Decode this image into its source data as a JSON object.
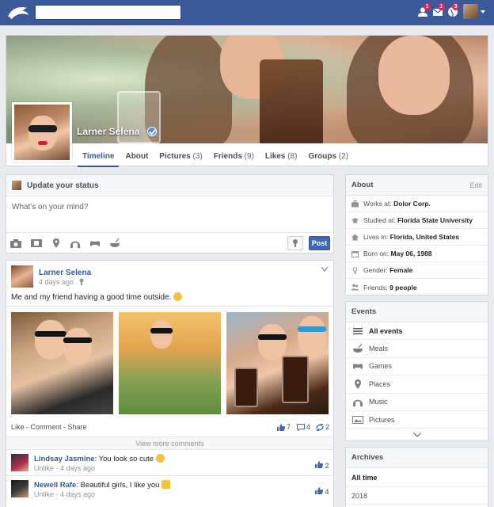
{
  "topbar": {
    "search_value": "",
    "notifications": [
      {
        "icon": "friend-requests-icon",
        "count": "1"
      },
      {
        "icon": "messages-icon",
        "count": "1"
      },
      {
        "icon": "globe-notifications-icon",
        "count": "3"
      }
    ],
    "brand_color": "#3b5998"
  },
  "profile": {
    "name": "Larner Selena",
    "tabs": [
      {
        "label": "Timeline",
        "count": ""
      },
      {
        "label": "About",
        "count": ""
      },
      {
        "label": "Pictures",
        "count": "(3)"
      },
      {
        "label": "Friends",
        "count": "(9)"
      },
      {
        "label": "Likes",
        "count": "(8)"
      },
      {
        "label": "Groups",
        "count": "(2)"
      }
    ]
  },
  "status": {
    "title": "Update your status",
    "placeholder": "What's on your mind?",
    "tools": [
      "camera-icon",
      "film-icon",
      "location-pin-icon",
      "headphones-icon",
      "gamepad-icon",
      "food-bowl-icon"
    ],
    "post_label": "Post"
  },
  "post": {
    "author": "Larner Selena",
    "time": "4 days ago",
    "text": "Me and my friend having a good time outside.",
    "actions": "Like - Comment - Share",
    "likes": "7",
    "comments": "4",
    "shares": "2",
    "more_comments": "View more comments",
    "comments_list": [
      {
        "author": "Lindsay Jasmine",
        "text": ": You look so cute",
        "meta": "Unlike - 4 days ago",
        "likes": "2"
      },
      {
        "author": "Newell Rafe",
        "text": ": Beautiful girls, I like you",
        "meta": "Unlike - 4 days ago",
        "likes": "4"
      }
    ]
  },
  "about": {
    "title": "About",
    "edit": "Edit",
    "rows": [
      {
        "icon": "briefcase-icon",
        "label": "Works at:",
        "value": "Dolor Corp."
      },
      {
        "icon": "graduation-cap-icon",
        "label": "Studied at:",
        "value": "Florida State University"
      },
      {
        "icon": "home-icon",
        "label": "Lives in:",
        "value": "Florida, United States"
      },
      {
        "icon": "calendar-icon",
        "label": "Born on:",
        "value": "May 06, 1988"
      },
      {
        "icon": "gender-icon",
        "label": "Gender:",
        "value": "Female"
      },
      {
        "icon": "friends-icon",
        "label": "Friends:",
        "value": "9 people"
      }
    ]
  },
  "events": {
    "title": "Events",
    "items": [
      {
        "icon": "list-icon",
        "label": "All events"
      },
      {
        "icon": "food-bowl-icon",
        "label": "Meals"
      },
      {
        "icon": "gamepad-icon",
        "label": "Games"
      },
      {
        "icon": "location-pin-icon",
        "label": "Places"
      },
      {
        "icon": "headphones-icon",
        "label": "Music"
      },
      {
        "icon": "picture-icon",
        "label": "Pictures"
      }
    ]
  },
  "archives": {
    "title": "Archives",
    "items": [
      "All time",
      "2018"
    ]
  }
}
